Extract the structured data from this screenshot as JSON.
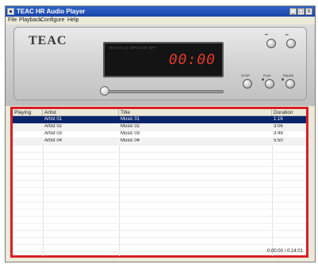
{
  "window": {
    "title": "TEAC HR Audio Player",
    "buttons": [
      "_",
      "□",
      "x"
    ]
  },
  "menu": [
    "File",
    "Playback",
    "Configure",
    "Help"
  ],
  "player": {
    "logo": "TEAC",
    "formats": "WAV FLAC MP3 DSF DFF",
    "time_display": "00:00",
    "buttons": {
      "prev": {
        "label": "⏮"
      },
      "next": {
        "label": "⏭"
      },
      "stop": {
        "label": "STOP"
      },
      "play": {
        "label": "PLAY"
      },
      "pause": {
        "label": "PAUSE"
      }
    },
    "seek_position": 0
  },
  "playlist": {
    "columns": [
      "Playing",
      "Artist",
      "Title",
      "Duration"
    ],
    "rows": [
      {
        "playing": "",
        "artist": "Artist 01",
        "title": "Music 01",
        "duration": "1:16",
        "selected": true
      },
      {
        "playing": "",
        "artist": "Artist 02",
        "title": "Music 02",
        "duration": "3:06",
        "selected": false
      },
      {
        "playing": "",
        "artist": "Artist 03",
        "title": "Music 03",
        "duration": "3:49",
        "selected": false
      },
      {
        "playing": "",
        "artist": "Artist 04",
        "title": "Music 04",
        "duration": "5:50",
        "selected": false
      }
    ],
    "total_time": "0:00:00 / 0:14:01"
  },
  "colors": {
    "selection": "#0a246a",
    "highlight_frame": "#d81f26",
    "display_digits": "#e43a2a",
    "title_bar": "#1a44a8"
  }
}
